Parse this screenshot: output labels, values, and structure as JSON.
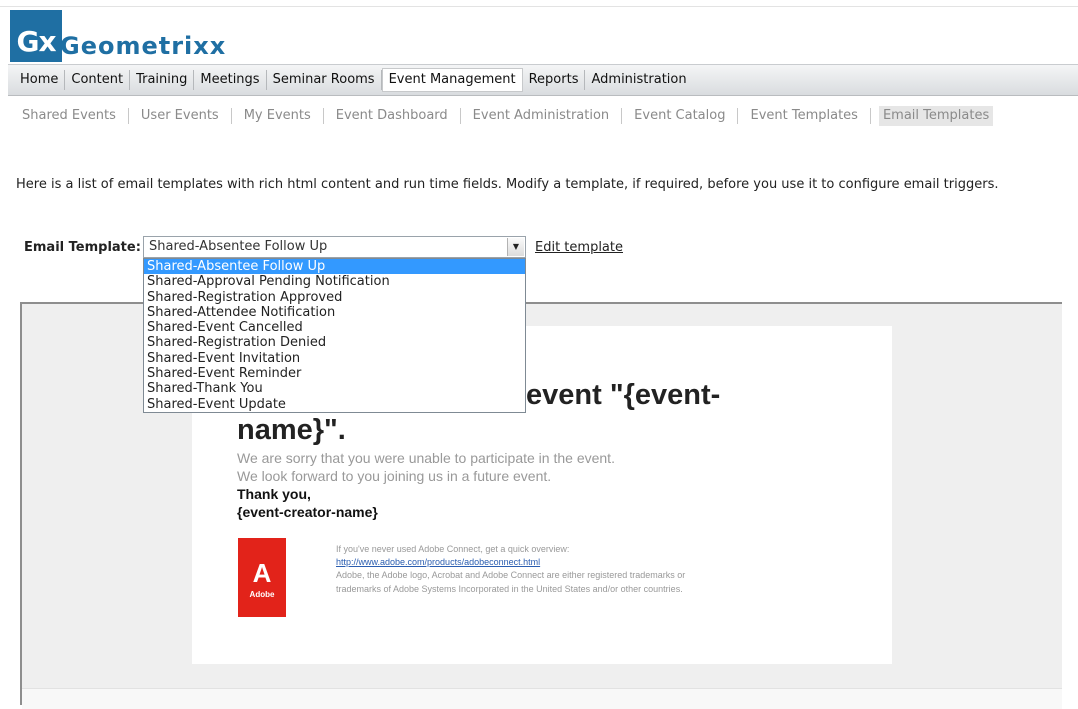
{
  "brand": {
    "mark": "Gx",
    "name": "Geometrixx",
    "color": "#1f6fa3"
  },
  "main_nav": [
    {
      "label": "Home"
    },
    {
      "label": "Content"
    },
    {
      "label": "Training"
    },
    {
      "label": "Meetings"
    },
    {
      "label": "Seminar Rooms"
    },
    {
      "label": "Event Management",
      "active": true
    },
    {
      "label": "Reports"
    },
    {
      "label": "Administration"
    }
  ],
  "sub_nav": [
    {
      "label": "Shared Events"
    },
    {
      "label": "User Events"
    },
    {
      "label": "My Events"
    },
    {
      "label": "Event Dashboard"
    },
    {
      "label": "Event Administration"
    },
    {
      "label": "Event Catalog"
    },
    {
      "label": "Event Templates"
    },
    {
      "label": "Email Templates",
      "active": true
    }
  ],
  "intro": "Here is a list of email templates with rich html content and run time fields. Modify a template, if required, before you use it to configure email triggers.",
  "picker": {
    "label": "Email Template:",
    "selected": "Shared-Absentee Follow Up",
    "edit_link": "Edit template",
    "options": [
      "Shared-Absentee Follow Up",
      "Shared-Approval Pending Notification",
      "Shared-Registration Approved",
      "Shared-Attendee Notification",
      "Shared-Event Cancelled",
      "Shared-Registration Denied",
      "Shared-Event Invitation",
      "Shared-Event Reminder",
      "Shared-Thank You",
      "Shared-Event Update"
    ],
    "highlight_color": "#3399ff"
  },
  "preview": {
    "headline_line1": "event \"{event-",
    "headline_line2": "name}\".",
    "body_line1": "We are sorry that you were unable to participate in the event.",
    "body_line2": "We look forward to you joining us in a future event.",
    "signoff": "Thank you,",
    "signature": "{event-creator-name}",
    "adobe_logo_glyph": "A",
    "adobe_logo_word": "Adobe",
    "footer_line1": "If you've never used Adobe Connect, get a quick overview:",
    "footer_link": "http://www.adobe.com/products/adobeconnect.html",
    "footer_line3": "Adobe, the Adobe logo, Acrobat and Adobe Connect are either registered trademarks or",
    "footer_line4": "trademarks of Adobe Systems Incorporated in the United States and/or other countries.",
    "adobe_red": "#e2231a"
  }
}
